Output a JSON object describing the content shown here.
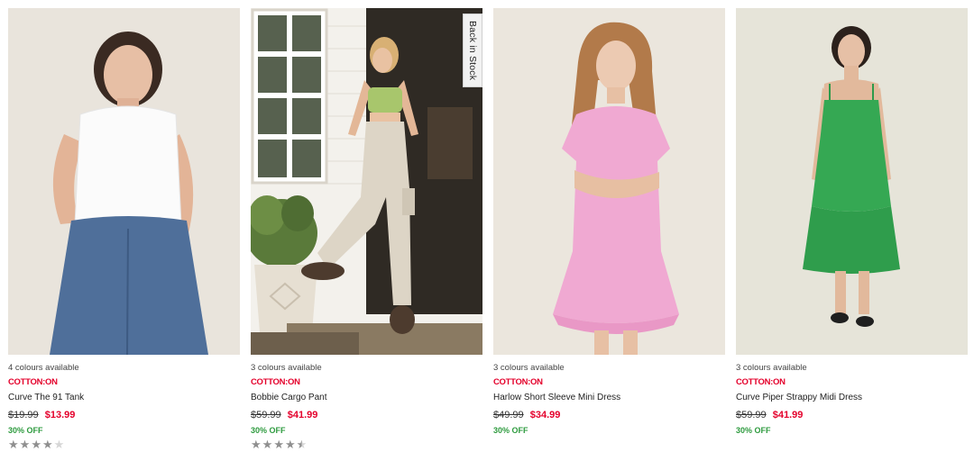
{
  "products": [
    {
      "colours": "4 colours available",
      "brand": "COTTON:ON",
      "name": "Curve The 91 Tank",
      "was_price": "$19.99",
      "now_price": "$13.99",
      "discount": "30% OFF",
      "rating": 4,
      "rating_max": 5,
      "badge": ""
    },
    {
      "colours": "3 colours available",
      "brand": "COTTON:ON",
      "name": "Bobbie Cargo Pant",
      "was_price": "$59.99",
      "now_price": "$41.99",
      "discount": "30% OFF",
      "rating": 4.5,
      "rating_max": 5,
      "badge": "Back in Stock"
    },
    {
      "colours": "3 colours available",
      "brand": "COTTON:ON",
      "name": "Harlow Short Sleeve Mini Dress",
      "was_price": "$49.99",
      "now_price": "$34.99",
      "discount": "30% OFF",
      "badge": ""
    },
    {
      "colours": "3 colours available",
      "brand": "COTTON:ON",
      "name": "Curve Piper Strappy Midi Dress",
      "was_price": "$59.99",
      "now_price": "$41.99",
      "discount": "30% OFF",
      "badge": ""
    }
  ],
  "colors": {
    "brand_red": "#e4002b",
    "discount_green": "#2e9b3f",
    "star_grey": "#8f8f8f"
  }
}
